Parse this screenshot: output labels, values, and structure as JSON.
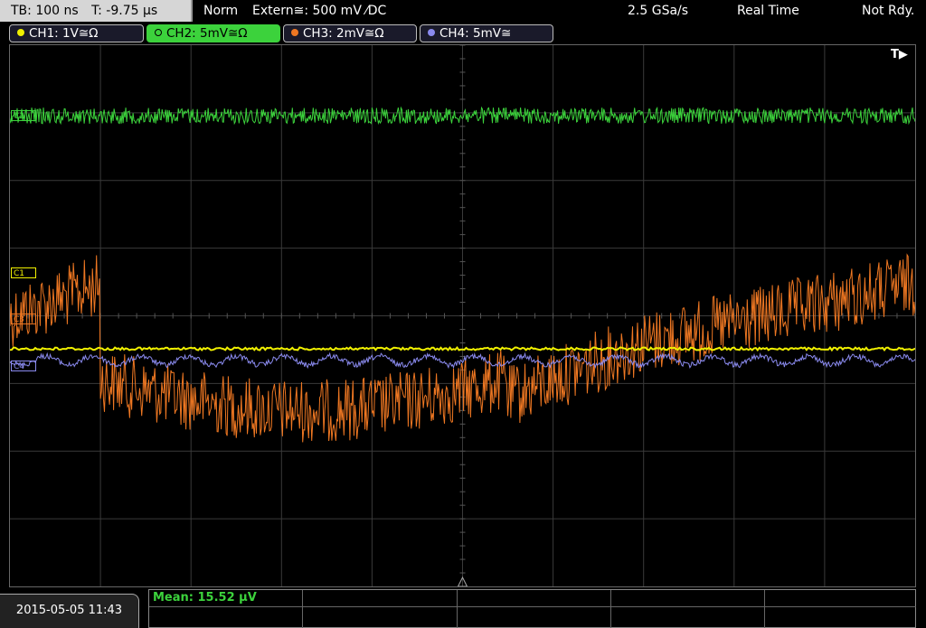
{
  "topbar": {
    "timebase": "TB: 100 ns",
    "trigger_time": "T: -9.75 µs",
    "acq_mode": "Norm",
    "trigger_source": "Extern≅: 500 mV ⁄DC",
    "sample_rate": "2.5 GSa/s",
    "time_mode": "Real Time",
    "run_state": "Not Rdy."
  },
  "channels": [
    {
      "label": "CH1: 1V≅Ω",
      "color": "#f0f000",
      "active": false
    },
    {
      "label": "CH2: 5mV≅Ω",
      "color": "#3cd23c",
      "active": true
    },
    {
      "label": "CH3: 2mV≅Ω",
      "color": "#ee7722",
      "active": false
    },
    {
      "label": "CH4: 5mV≅",
      "color": "#8a8aee",
      "active": false
    }
  ],
  "markers": {
    "c1": "C1",
    "c2": "C2",
    "c3": "C3",
    "c4": "C4",
    "trigger_position": "T▶"
  },
  "footer": {
    "datetime": "2015-05-05 11:43",
    "measurement": "Mean: 15.52 µV"
  },
  "colors": {
    "ch1": "#f0f000",
    "ch2": "#3cd23c",
    "ch3": "#ee7722",
    "ch4": "#8a8aee",
    "grid": "#3a3a3a"
  }
}
